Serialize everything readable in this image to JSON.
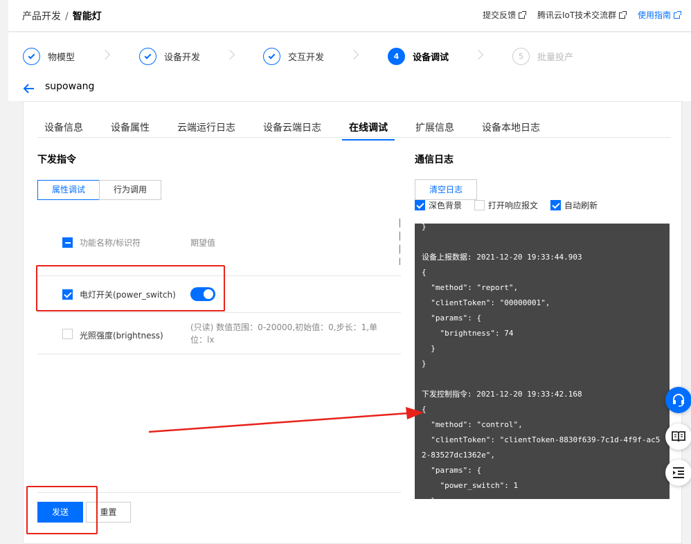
{
  "breadcrumb": {
    "parent": "产品开发",
    "separator": "/",
    "current": "智能灯"
  },
  "top_links": {
    "feedback": "提交反馈",
    "community": "腾讯云IoT技术交流群",
    "guide": "使用指南"
  },
  "steps": [
    {
      "label": "物模型",
      "status": "done"
    },
    {
      "label": "设备开发",
      "status": "done"
    },
    {
      "label": "交互开发",
      "status": "done"
    },
    {
      "number": "4",
      "label": "设备调试",
      "status": "active"
    },
    {
      "number": "5",
      "label": "批量投产",
      "status": "pending"
    }
  ],
  "device": {
    "name": "supowang"
  },
  "tabs": [
    {
      "label": "设备信息"
    },
    {
      "label": "设备属性"
    },
    {
      "label": "云端运行日志"
    },
    {
      "label": "设备云端日志"
    },
    {
      "label": "在线调试",
      "active": true
    },
    {
      "label": "扩展信息"
    },
    {
      "label": "设备本地日志"
    }
  ],
  "commands": {
    "title": "下发指令",
    "segments": {
      "property": "属性调试",
      "action": "行为调用"
    },
    "table": {
      "col_name": "功能名称/标识符",
      "col_value": "期望值",
      "rows": [
        {
          "name": "电灯开关(power_switch)",
          "checked": true,
          "toggle_on": true
        },
        {
          "name": "光照强度(brightness)",
          "checked": false,
          "desc_line1": "(只读) 数值范围：0-20000,初始值：0,步长：1,单",
          "desc_line2": "位：lx"
        }
      ]
    },
    "send_label": "发送",
    "reset_label": "重置"
  },
  "log": {
    "title": "通信日志",
    "clear_label": "清空日志",
    "options": {
      "dark_bg": {
        "label": "深色背景",
        "checked": true
      },
      "show_reply": {
        "label": "打开响应报文",
        "checked": false
      },
      "auto_refresh": {
        "label": "自动刷新",
        "checked": true
      }
    },
    "content": "}\n\n设备上报数据: 2021-12-20 19:33:44.903\n{\n  \"method\": \"report\",\n  \"clientToken\": \"00000001\",\n  \"params\": {\n    \"brightness\": 74\n  }\n}\n\n下发控制指令: 2021-12-20 19:33:42.168\n{\n  \"method\": \"control\",\n  \"clientToken\": \"clientToken-8830f639-7c1d-4f9f-ac52-83527dc1362e\",\n  \"params\": {\n    \"power_switch\": 1\n  }\n}"
  },
  "colors": {
    "accent": "#006eff",
    "annotation": "#e8211a",
    "console_bg": "#464646"
  },
  "icons": {
    "back": "arrow-left-icon",
    "support": "headset-icon",
    "docs": "book-icon",
    "menu": "indent-icon",
    "external": "external-link-icon"
  }
}
